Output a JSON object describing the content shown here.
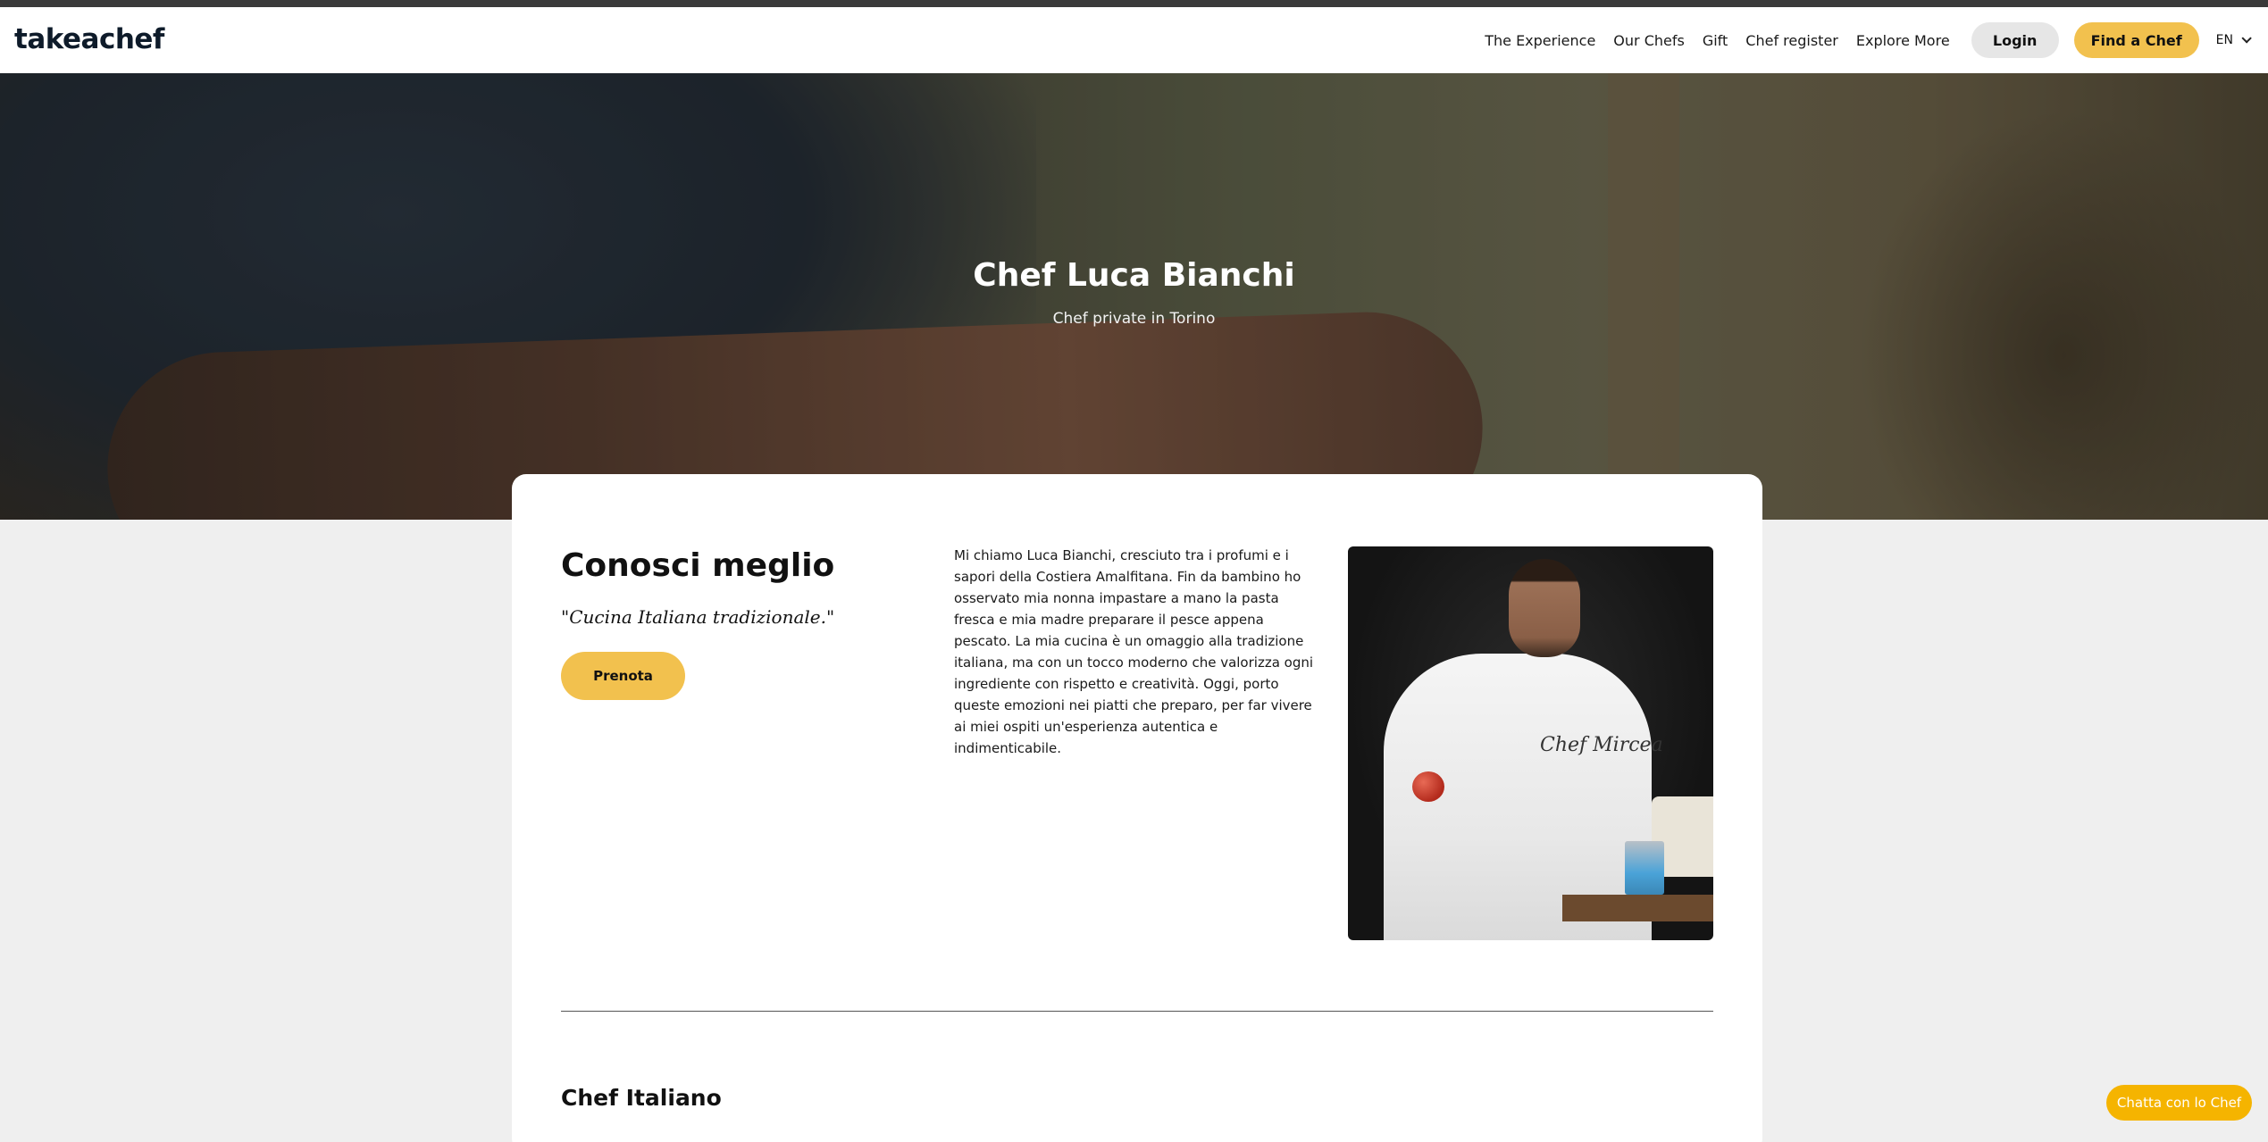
{
  "header": {
    "logo": "takeachef",
    "nav": [
      "The Experience",
      "Our Chefs",
      "Gift",
      "Chef register",
      "Explore More"
    ],
    "login_label": "Login",
    "find_label": "Find a Chef",
    "language": "EN"
  },
  "hero": {
    "title": "Chef Luca Bianchi",
    "subtitle": "Chef private in Torino"
  },
  "about": {
    "title": "Conosci meglio",
    "quote": "\"Cucina Italiana tradizionale.\"",
    "book_label": "Prenota",
    "bio": "Mi chiamo Luca Bianchi, cresciuto tra i profumi e i sapori della Costiera Amalfitana. Fin da bambino ho osservato mia nonna impastare a mano la pasta fresca e mia madre preparare il pesce appena pescato. La mia cucina è un omaggio alla tradizione italiana, ma con un tocco moderno che valorizza ogni ingrediente con rispetto e creatività. Oggi, porto queste emozioni nei piatti che preparo, per far vivere ai miei ospiti un'esperienza autentica e indimenticabile.",
    "portrait_text": "Chef Mircea"
  },
  "section": {
    "title": "Chef Italiano"
  },
  "chat": {
    "label": "Chatta con lo Chef"
  },
  "colors": {
    "accent": "#f2c14e",
    "chat": "#f5b400"
  }
}
